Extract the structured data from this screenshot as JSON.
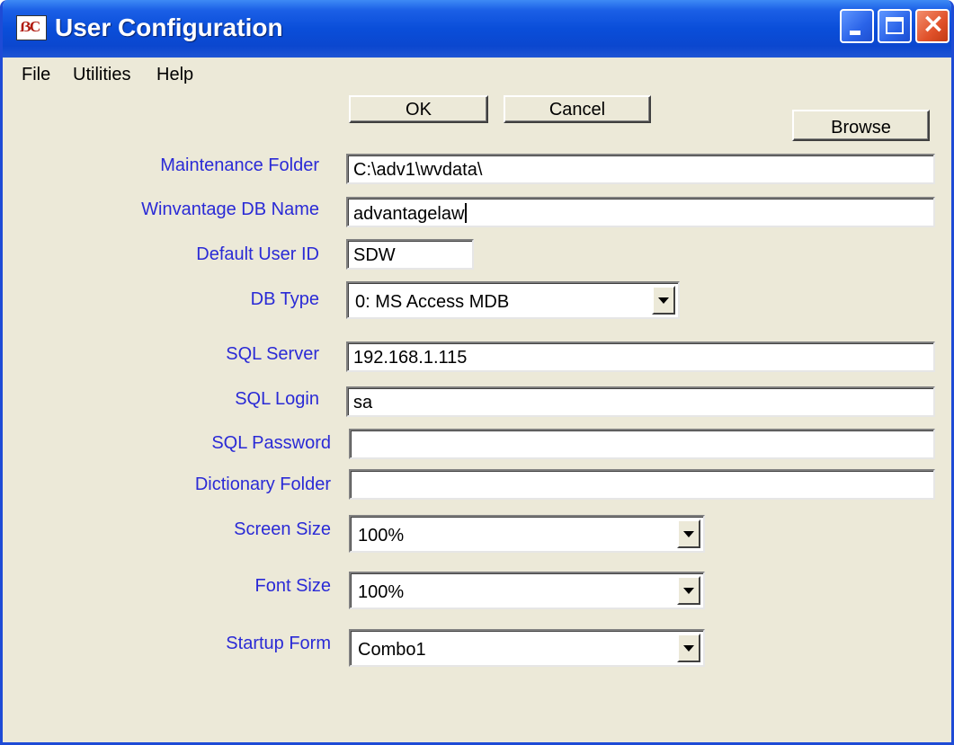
{
  "window": {
    "title": "User Configuration",
    "icon": "app-icon"
  },
  "menu": {
    "items": [
      "File",
      "Utilities",
      "Help"
    ]
  },
  "buttons": {
    "ok": "OK",
    "cancel": "Cancel",
    "browse": "Browse"
  },
  "fields": {
    "maintenance_folder": {
      "label": "Maintenance Folder",
      "value": "C:\\adv1\\wvdata\\"
    },
    "winvantage_db_name": {
      "label": "Winvantage DB Name",
      "value": "advantagelaw"
    },
    "default_user_id": {
      "label": "Default User ID",
      "value": "SDW"
    },
    "db_type": {
      "label": "DB Type",
      "value": "0: MS Access MDB"
    },
    "sql_server": {
      "label": "SQL Server",
      "value": "192.168.1.115"
    },
    "sql_login": {
      "label": "SQL Login",
      "value": "sa"
    },
    "sql_password": {
      "label": "SQL Password",
      "value": ""
    },
    "dictionary_folder": {
      "label": "Dictionary Folder",
      "value": ""
    },
    "screen_size": {
      "label": "Screen Size",
      "value": "100%"
    },
    "font_size": {
      "label": "Font Size",
      "value": "100%"
    },
    "startup_form": {
      "label": "Startup Form",
      "value": "Combo1"
    }
  },
  "colors": {
    "label": "#2a2ad6",
    "titlebar": "#0a4ed9",
    "window_bg": "#ece9d8"
  }
}
